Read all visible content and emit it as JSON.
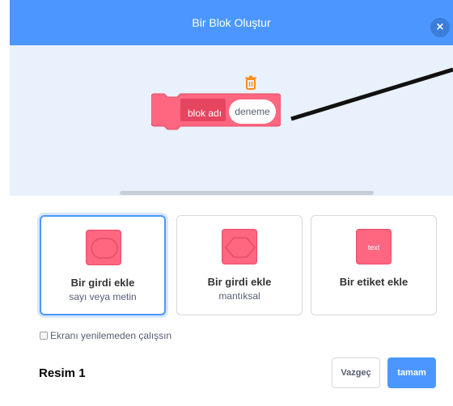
{
  "dialog": {
    "title": "Bir Blok Oluştur",
    "close_icon": "close-icon",
    "close_label": "×"
  },
  "workspace": {
    "trash_icon": "trash-icon",
    "block_label": "blok adı",
    "block_input_value": "deneme"
  },
  "options": [
    {
      "title": "Bir girdi ekle",
      "subtitle": "sayı veya metin",
      "icon": "round-input-icon",
      "selected": true
    },
    {
      "title": "Bir girdi ekle",
      "subtitle": "mantıksal",
      "icon": "boolean-input-icon",
      "selected": false
    },
    {
      "title": "Bir etiket ekle",
      "subtitle": "",
      "icon": "label-icon",
      "icon_text": "text",
      "selected": false
    }
  ],
  "checkbox": {
    "label": "Ekranı yenilemeden çalışsın",
    "checked": false
  },
  "caption": "Resim 1",
  "buttons": {
    "cancel": "Vazgeç",
    "ok": "tamam"
  },
  "colors": {
    "header": "#4c97ff",
    "workspace": "#e9f1fc",
    "block": "#ff6680",
    "block_dark": "#e64d66",
    "accent": "#4c97ff",
    "trash": "#ff8c1a"
  }
}
